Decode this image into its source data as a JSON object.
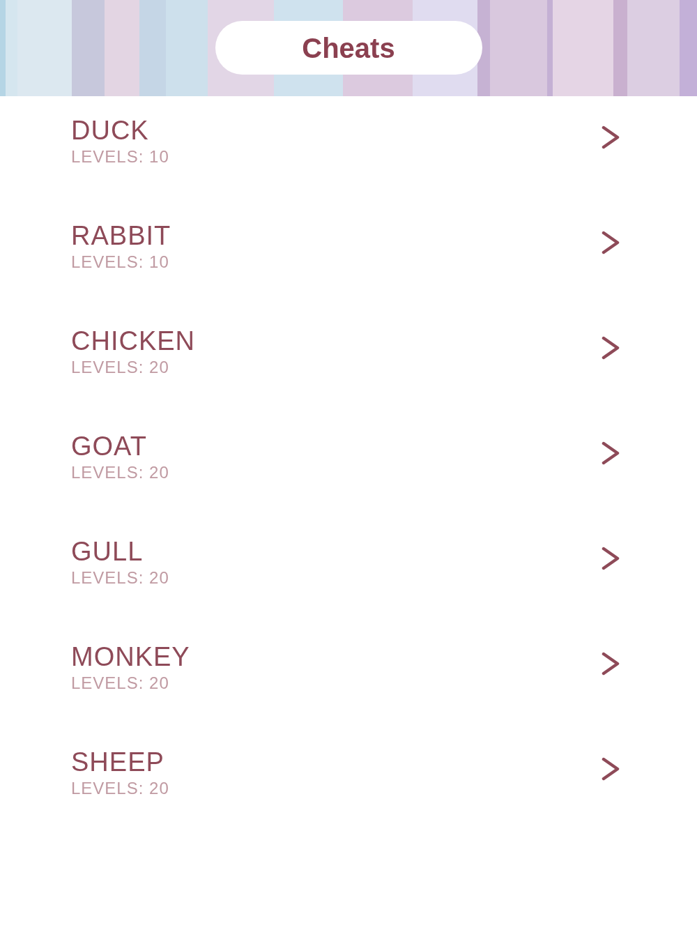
{
  "header": {
    "title": "Cheats"
  },
  "items": [
    {
      "name": "DUCK",
      "levels": "LEVELS: 10"
    },
    {
      "name": "RABBIT",
      "levels": "LEVELS: 10"
    },
    {
      "name": "CHICKEN",
      "levels": "LEVELS: 20"
    },
    {
      "name": "GOAT",
      "levels": "LEVELS: 20"
    },
    {
      "name": "GULL",
      "levels": "LEVELS: 20"
    },
    {
      "name": "MONKEY",
      "levels": "LEVELS: 20"
    },
    {
      "name": "SHEEP",
      "levels": "LEVELS: 20"
    }
  ]
}
